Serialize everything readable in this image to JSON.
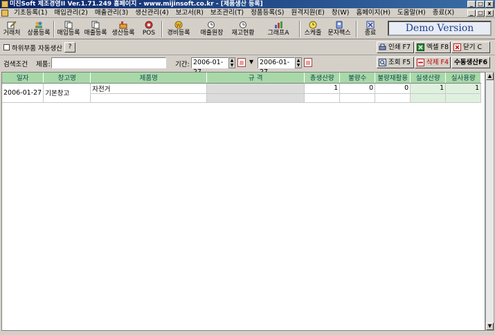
{
  "window": {
    "title": "미진Soft 제조경영II Ver.1.71.249   홈페이지 - www.mijinsoft.co.kr - [제품생산 등록]"
  },
  "menu": {
    "items": [
      "기초등록(1)",
      "매입관리(2)",
      "매출관리(3)",
      "생산관리(4)",
      "보고서(R)",
      "보조관리(T)",
      "정품등록(S)",
      "원격지원(E)",
      "창(W)",
      "홈페이지(H)",
      "도움말(H)",
      "종료(X)"
    ]
  },
  "toolbar": {
    "buttons": [
      "거래처",
      "상품등록",
      "매입등록",
      "매출등록",
      "생산등록",
      "POS",
      "경비등록",
      "매출원장",
      "재고현황",
      "그래프A",
      "스케줄",
      "문자팩스",
      "종료"
    ],
    "demo_label": "Demo Version"
  },
  "options": {
    "auto_produce_label": "하위부품 자동생산",
    "help_label": "?",
    "print_label": "인쇄 F7",
    "excel_label": "엑셀 F8",
    "close_label": "닫기 C",
    "search_label": "조회 F5",
    "delete_label": "삭제 F4",
    "manual_label": "수동생산F6"
  },
  "search": {
    "condition_label": "검색조건",
    "product_label": "제품:",
    "product_value": "",
    "period_label": "기간:",
    "date_from": "2006-01-27",
    "date_to": "2006-01-27"
  },
  "grid": {
    "columns": [
      "일자",
      "창고명",
      "제품명",
      "규 격",
      "총생산량",
      "불량수",
      "불량재활용",
      "실생산량",
      "실사용량"
    ],
    "rows": [
      {
        "date": "2006-01-27",
        "warehouse": "기본창고",
        "product": "자전거",
        "spec": "",
        "total": "1",
        "defect": "0",
        "recycle": "0",
        "actual": "1",
        "used": "1"
      }
    ]
  },
  "colors": {
    "header_green": "#a8d8a8",
    "title_blue": "#0a246a"
  }
}
